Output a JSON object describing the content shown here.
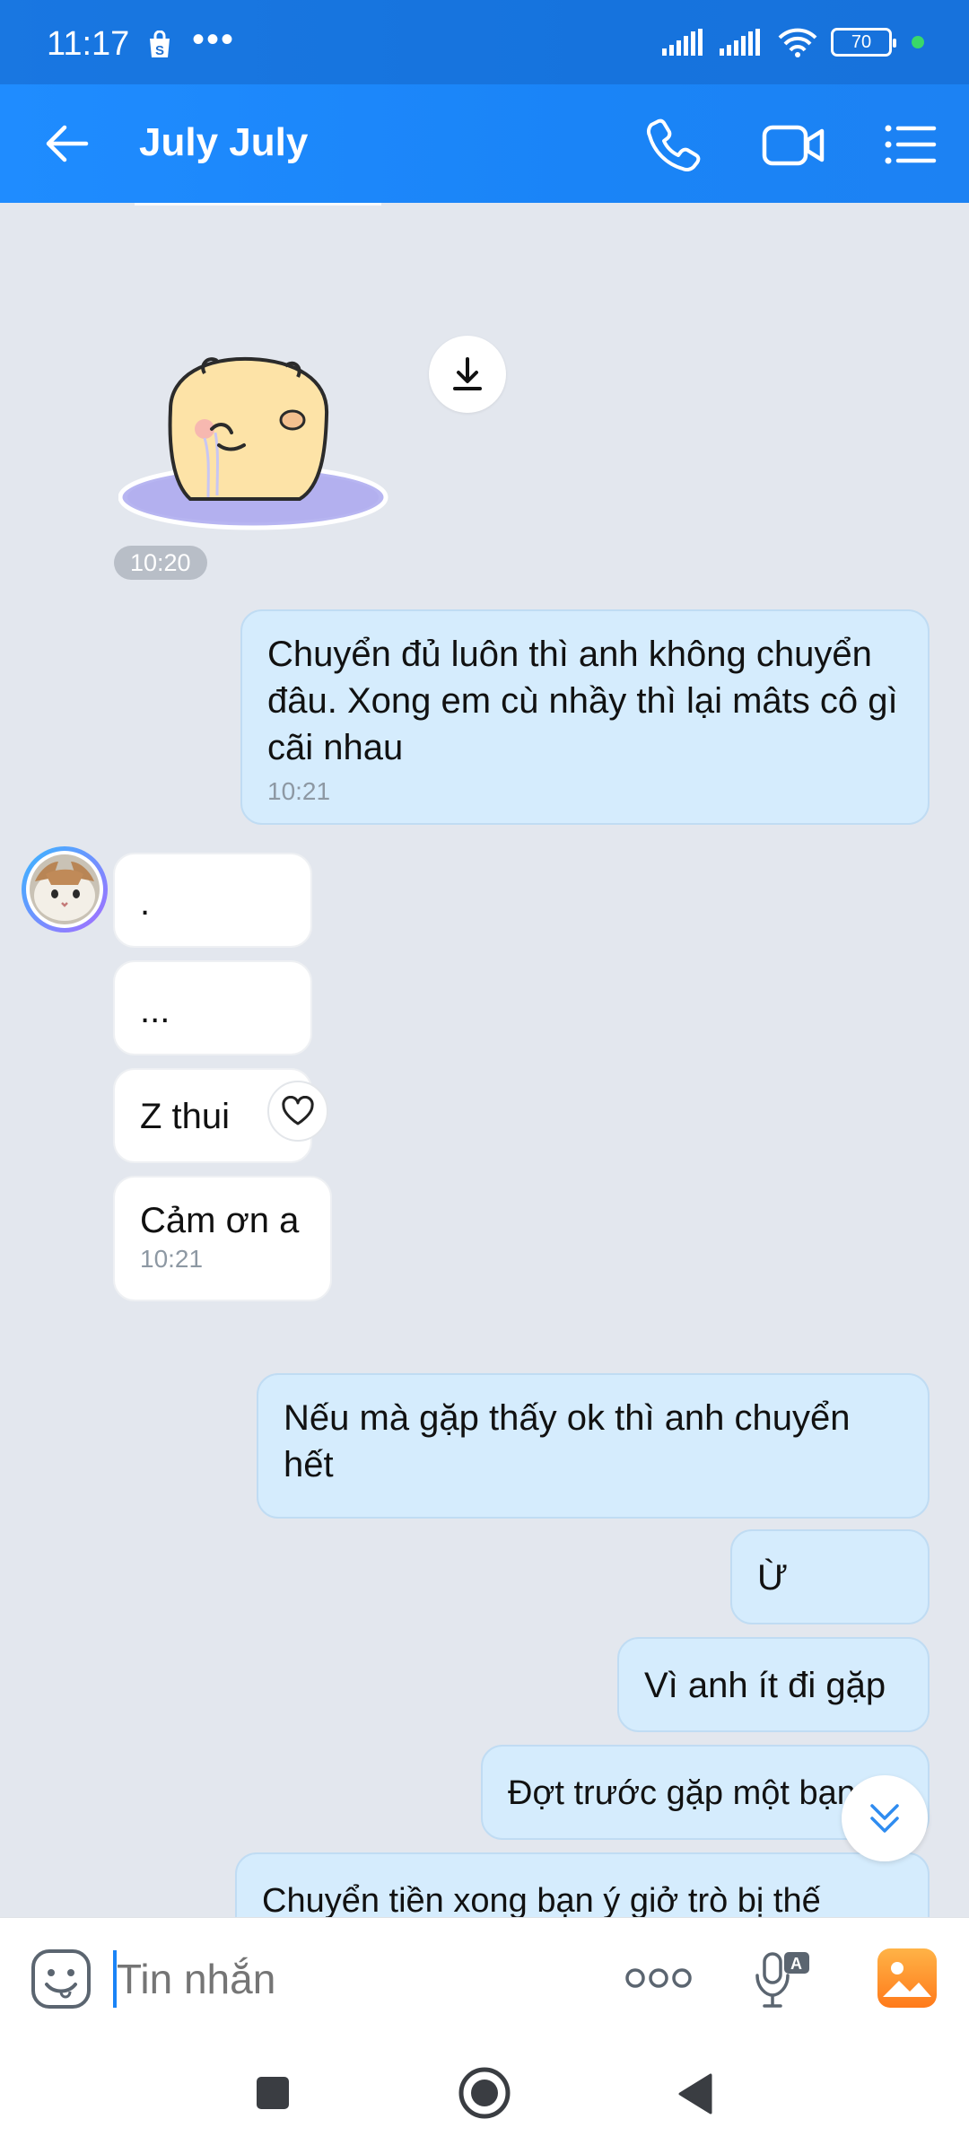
{
  "status": {
    "time": "11:17",
    "dots": "•••",
    "battery": "70"
  },
  "header": {
    "title": "July July",
    "icons": [
      "back-arrow-icon",
      "phone-icon",
      "video-call-icon",
      "menu-list-icon"
    ]
  },
  "messages": [
    {
      "side": "in",
      "type": "sticker",
      "time": "10:20"
    },
    {
      "side": "out",
      "text": "Chuyển đủ luôn thì anh không chuyển đâu. Xong em cù nhầy thì lại mâts cô gì cãi nhau",
      "time": "10:21"
    },
    {
      "side": "in",
      "text": "."
    },
    {
      "side": "in",
      "text": "..."
    },
    {
      "side": "in",
      "text": "Z thui"
    },
    {
      "side": "in",
      "text": "Cảm ơn a",
      "time": "10:21"
    },
    {
      "side": "out",
      "text": "Nếu mà gặp thấy ok thì anh chuyển hết"
    },
    {
      "side": "out",
      "text": "Ừ"
    },
    {
      "side": "out",
      "text": "Vì anh ít đi gặp"
    },
    {
      "side": "out",
      "text": "Đợt trước gặp một bạn"
    },
    {
      "side": "out",
      "text": "Chuyển tiền xong bạn ý giở trò bị thế"
    }
  ],
  "input": {
    "placeholder": "Tin nhắn"
  },
  "colors": {
    "header": "#1a84f7",
    "outgoing_bubble": "#d5ecfd",
    "incoming_bubble": "#ffffff",
    "chat_background": "#e3e7ee"
  }
}
